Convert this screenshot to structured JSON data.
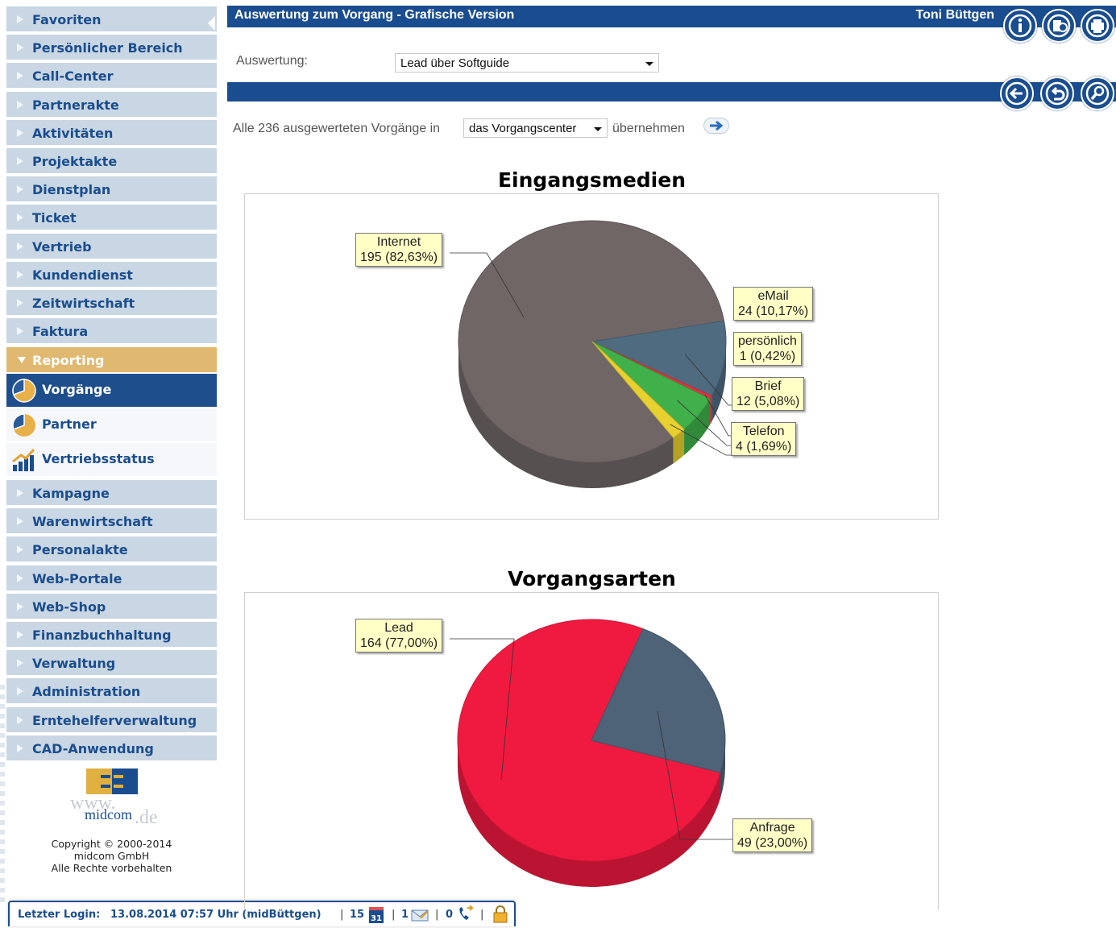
{
  "sidebar": {
    "items_top": [
      "Favoriten",
      "Persönlicher Bereich",
      "Call-Center",
      "Partnerakte",
      "Aktivitäten",
      "Projektakte",
      "Dienstplan",
      "Ticket",
      "Vertrieb",
      "Kundendienst",
      "Zeitwirtschaft",
      "Faktura"
    ],
    "section": "Reporting",
    "sub_items": [
      "Vorgänge",
      "Partner",
      "Vertriebsstatus"
    ],
    "items_bottom": [
      "Kampagne",
      "Warenwirtschaft",
      "Personalakte",
      "Web-Portale",
      "Web-Shop",
      "Finanzbuchhaltung",
      "Verwaltung",
      "Administration",
      "Erntehelferverwaltung",
      "CAD-Anwendung"
    ],
    "logo_text": "www.midcom.de",
    "copyright": [
      "Copyright © 2000-2014",
      "midcom GmbH",
      "Alle Rechte vorbehalten"
    ]
  },
  "status": {
    "login_label": "Letzter Login:",
    "login_value": "13.08.2014 07:57 Uhr (midBüttgen)",
    "calendar_count": "15",
    "calendar_day": "31",
    "mail_count": "1",
    "call_count": "0",
    "sep": "|"
  },
  "header": {
    "title": "Auswertung zum Vorgang - Grafische Version",
    "user": "Toni Büttgen",
    "icons": [
      "info-icon",
      "settings-icon",
      "print-icon",
      "back-icon",
      "undo-icon",
      "search-icon"
    ]
  },
  "form": {
    "auswertung_label": "Auswertung:",
    "auswertung_value": "Lead über Softguide",
    "transfer_prefix": "Alle 236 ausgewerteten Vorgänge in",
    "transfer_target": "das Vorgangscenter",
    "transfer_suffix": "übernehmen"
  },
  "colors": {
    "nav_bg": "#c9d6e3",
    "nav_text": "#1a4d8f",
    "header_blue": "#1a4d8f",
    "section": "#e0b870"
  },
  "chart_data": [
    {
      "type": "pie",
      "title": "Eingangsmedien",
      "slices": [
        {
          "label": "Internet",
          "value": 195,
          "percent": "82,63%",
          "color": "#706666"
        },
        {
          "label": "eMail",
          "value": 24,
          "percent": "10,17%",
          "color": "#4f6b80"
        },
        {
          "label": "persönlich",
          "value": 1,
          "percent": "0,42%",
          "color": "#e83040"
        },
        {
          "label": "Brief",
          "value": 12,
          "percent": "5,08%",
          "color": "#3fb04a"
        },
        {
          "label": "Telefon",
          "value": 4,
          "percent": "1,69%",
          "color": "#e8d030"
        }
      ],
      "labels": [
        "Internet\n195 (82,63%)",
        "eMail\n24 (10,17%)",
        "persönlich\n1 (0,42%)",
        "Brief\n12 (5,08%)",
        "Telefon\n4 (1,69%)"
      ]
    },
    {
      "type": "pie",
      "title": "Vorgangsarten",
      "slices": [
        {
          "label": "Lead",
          "value": 164,
          "percent": "77,00%",
          "color": "#f01a40"
        },
        {
          "label": "Anfrage",
          "value": 49,
          "percent": "23,00%",
          "color": "#4e6278"
        }
      ]
    }
  ]
}
